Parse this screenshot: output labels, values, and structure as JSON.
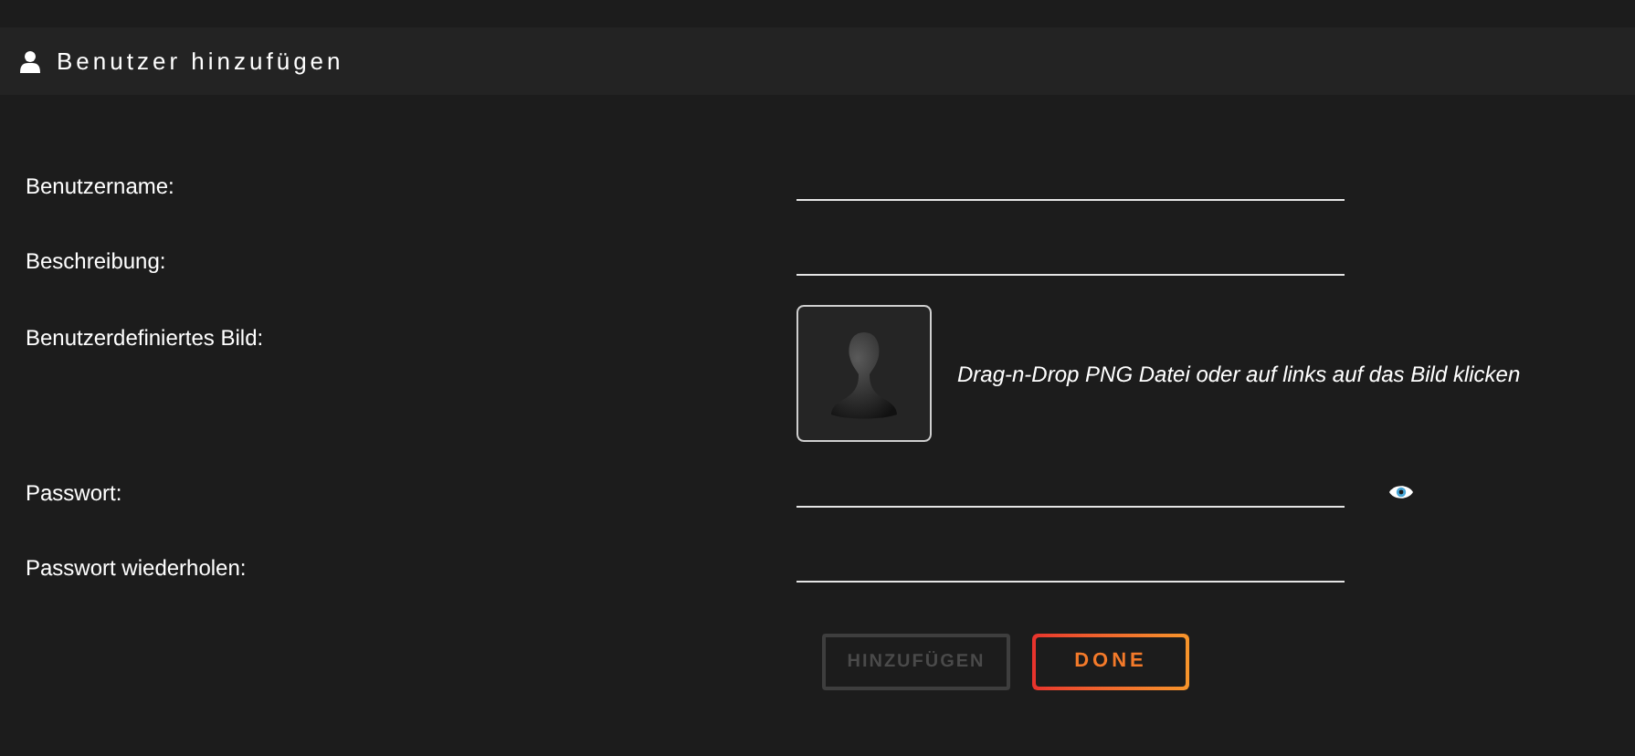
{
  "header": {
    "title": "Benutzer hinzufügen"
  },
  "fields": [
    {
      "kind": "text",
      "label": "Benutzername:"
    },
    {
      "kind": "text",
      "label": "Beschreibung:"
    },
    {
      "kind": "image",
      "label": "Benutzerdefiniertes Bild:",
      "hint": "Drag-n-Drop PNG Datei oder auf links auf das Bild klicken"
    },
    {
      "kind": "password",
      "label": "Passwort:"
    },
    {
      "kind": "text",
      "label": "Passwort wiederholen:"
    }
  ],
  "buttons": [
    {
      "label": "HINZUFÜGEN",
      "disabled": true
    },
    {
      "label": "DONE",
      "disabled": false
    }
  ]
}
